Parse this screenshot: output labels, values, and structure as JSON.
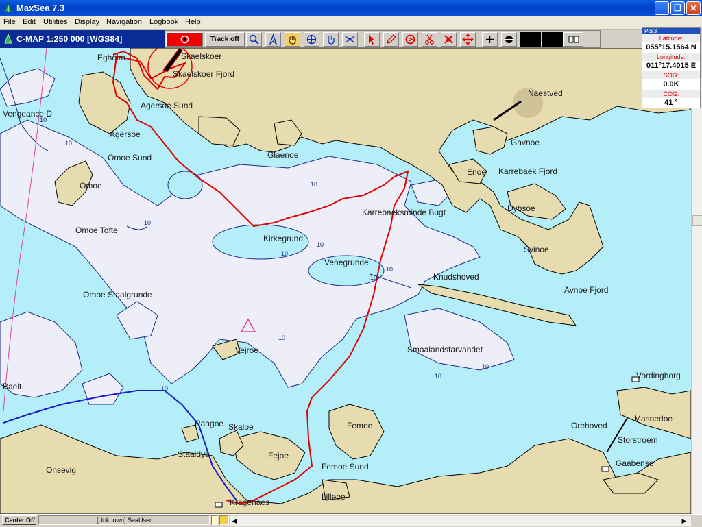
{
  "window": {
    "title": "MaxSea 7.3"
  },
  "menu": [
    "File",
    "Edit",
    "Utilities",
    "Display",
    "Navigation",
    "Logbook",
    "Help"
  ],
  "chart_header": {
    "label": "C-MAP  1:250 000 [WGS84]"
  },
  "toolbar": {
    "track_label": "Track off",
    "buttons": [
      "record-icon",
      "zoom-icon",
      "compass-icon",
      "hand-icon",
      "crosshair-icon",
      "hand-point-icon",
      "tide-icon",
      "cursor-icon",
      "pencil-icon",
      "route-icon",
      "scissors-icon",
      "erase-icon",
      "move-icon",
      "plus-icon",
      "target-icon",
      "window-icon"
    ]
  },
  "position": {
    "header": "Pos3",
    "latitude_label": "Latitude:",
    "latitude": "055°15.1564 N",
    "longitude_label": "Longitude:",
    "longitude": "011°17.4015 E",
    "sog_label": "SOG:",
    "sog": "0.0K",
    "cog_label": "COG:",
    "cog": "41 °"
  },
  "status": {
    "center_off": "Center Off",
    "user": "[Unknown] SeaUser"
  },
  "places": {
    "egholm": "Egholm",
    "skaelskoer": "Skaelskoer",
    "skaelskoer_fjord": "Skaelskoer Fjord",
    "naestved": "Naestved",
    "vengeance": "Vengeance D",
    "agersoe_sund": "Agersoe Sund",
    "agersoe": "Agersoe",
    "omoe_sund": "Omoe Sund",
    "glaenoe": "Glaenoe",
    "gavnoe": "Gavnoe",
    "enoe": "Enoe",
    "karrebaek_fjord": "Karrebaek Fjord",
    "omoe": "Omoe",
    "dybsoe": "Dybsoe",
    "karrebaeksminde_bugt": "Karrebaeksminde Bugt",
    "omoe_tofte": "Omoe Tofte",
    "kirkegrund": "Kirkegrund",
    "svinoe": "Svinoe",
    "venegrunde": "Venegrunde",
    "knudshoved": "Knudshoved",
    "avnoe_fjord": "Avnoe Fjord",
    "omoe_staalgrunde": "Omoe Staalgrunde",
    "vejroe": "Vejroe",
    "smaalandsfarvandet": "Smaalandsfarvandet",
    "vordingborg": "Vordingborg",
    "baelt": "Baelt",
    "raagoe": "Raagoe",
    "skaloe": "Skaloe",
    "femoe": "Femoe",
    "masnedoe": "Masnedoe",
    "orehoved": "Orehoved",
    "storstroem": "Storstroem",
    "staaldyb": "Staaldyb",
    "fejoe": "Fejoe",
    "gaabense": "Gaabense",
    "onsevig": "Onsevig",
    "femoe_sund": "Femoe Sund",
    "kragenaes": "Kragenaes",
    "lilleoe": "Lilleoe"
  },
  "depth_label": "10",
  "colors": {
    "land": "#e6dcb0",
    "water": "#b4eef8",
    "shallow": "#eeeef8",
    "track_red": "#e00000",
    "route_blue": "#1a1ad0",
    "chart_header": "#0a2c96"
  }
}
